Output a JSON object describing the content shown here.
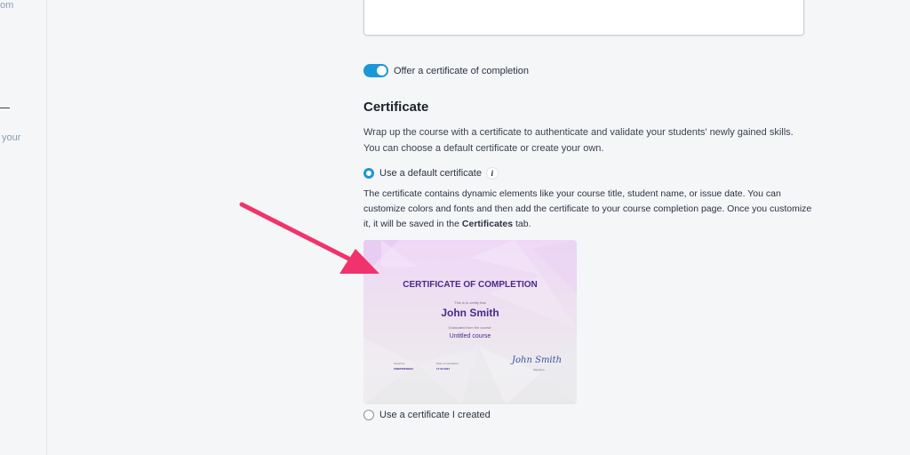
{
  "sidebar": {
    "fragment_top": "om",
    "fragment_mid": "your"
  },
  "settings": {
    "toggle_label": "Offer a certificate of completion",
    "toggle_on": true
  },
  "certificate_section": {
    "title": "Certificate",
    "description_line1": "Wrap up the course with a certificate to authenticate and validate your students' newly gained skills.",
    "description_line2": "You can choose a default certificate or create your own.",
    "option_default_label": "Use a default certificate",
    "info_icon_glyph": "i",
    "default_description_before": "The certificate contains dynamic elements like your course title, student name, or issue date. You can customize colors and fonts and then add the certificate to your course completion page. Once you customize it, it will be saved in the ",
    "default_description_bold": "Certificates",
    "default_description_after": " tab.",
    "option_created_label": "Use a certificate I created",
    "selected_option": "default"
  },
  "certificate_preview": {
    "title": "CERTIFICATE OF COMPLETION",
    "certify_text": "This is to certify that",
    "student_name": "John Smith",
    "graduated_text": "Graduated from the course:",
    "course_name": "Untitled course",
    "serial_label": "Serial No.",
    "serial_value": "CMBTIDE3BDH",
    "date_label": "Date of completion",
    "date_value": "17.02.2024",
    "signature": "John Smith",
    "signature_label": "Signature"
  },
  "colors": {
    "accent": "#1a98d5",
    "annotation_arrow": "#f0336c",
    "certificate_title": "#4a2a8c"
  }
}
